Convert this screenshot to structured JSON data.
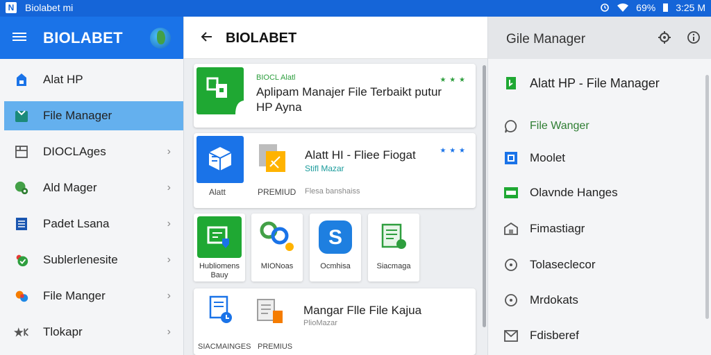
{
  "status_bar": {
    "app_name": "Biolabet mi",
    "battery": "69%",
    "time": "3:25 M"
  },
  "sidebar": {
    "title": "BIOLABET",
    "items": [
      {
        "label": "Alat HP",
        "icon": "home-icon",
        "chevron": false
      },
      {
        "label": "File Manager",
        "icon": "folder-icon",
        "chevron": false,
        "active": true
      },
      {
        "label": "DIOCLAges",
        "icon": "package-icon",
        "chevron": true
      },
      {
        "label": "Ald Mager",
        "icon": "android-icon",
        "chevron": true
      },
      {
        "label": "Padet Lsana",
        "icon": "document-icon",
        "chevron": true
      },
      {
        "label": "Sublerlenesite",
        "icon": "check-shield-icon",
        "chevron": true
      },
      {
        "label": "File Manger",
        "icon": "palette-icon",
        "chevron": true
      },
      {
        "label": "Tlokapr",
        "icon": "star-icon",
        "chevron": true
      }
    ]
  },
  "middle": {
    "title": "BIOLABET",
    "featured": {
      "tag": "BIOCL Alatl",
      "title": "Aplipam Manajer File Terbaikt putur HP Ayna",
      "rating": "★ ★ ★"
    },
    "card2": {
      "title": "Alatt HI - Fliee Fiogat",
      "subtitle": "Stifl Mazar",
      "rating": "★ ★ ★",
      "label_1": "Alatt",
      "label_2": "PREMIUD",
      "label_3": "Flesa banshaiss"
    },
    "tiles": [
      {
        "label": "Hubliomens Bauy",
        "icon": "shield-doc-icon"
      },
      {
        "label": "MIONoas",
        "icon": "link-icon"
      },
      {
        "label": "Ocmhisa",
        "icon": "s-app-icon"
      },
      {
        "label": "Siacmaga",
        "icon": "spreadsheet-icon"
      }
    ],
    "card4": {
      "title": "Mangar Flle File Kajua",
      "subtitle": "PlioMazar",
      "label_1": "SIACMAINGES",
      "label_2": "PREMIUS"
    }
  },
  "right": {
    "title": "Gile Manager",
    "items": [
      {
        "label": "Alatt HP - File Manager",
        "icon": "green-bookmark-icon",
        "style": "top"
      },
      {
        "label": "File Wanger",
        "icon": "chat-bubble-icon",
        "style": "green"
      },
      {
        "label": "Moolet",
        "icon": "image-icon",
        "style": ""
      },
      {
        "label": "Olavnde Hanges",
        "icon": "card-icon",
        "style": ""
      },
      {
        "label": "Fimastiagr",
        "icon": "house-icon",
        "style": ""
      },
      {
        "label": "Tolaseclecor",
        "icon": "circle-dot-icon",
        "style": ""
      },
      {
        "label": "Mrdokats",
        "icon": "circle-dot-icon",
        "style": ""
      },
      {
        "label": "Fdisberef",
        "icon": "envelope-icon",
        "style": ""
      }
    ]
  },
  "colors": {
    "status_bar": "#1565d8",
    "sidebar_header": "#1a73e8",
    "active_item": "#64b0ee",
    "green_accent": "#1fa833"
  }
}
